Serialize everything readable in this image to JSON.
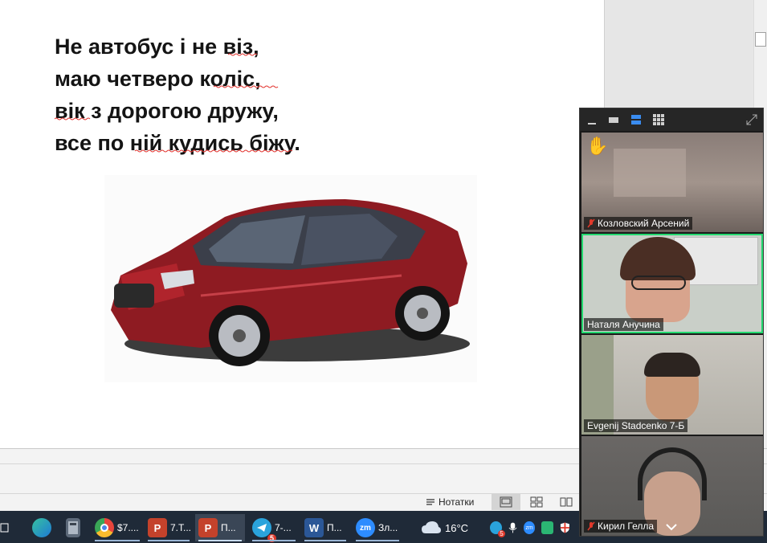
{
  "slide": {
    "poem": [
      "Не автобус і не віз,",
      "маю четверо коліс,",
      "вік з дорогою дружу,",
      "все по ній кудись біжу."
    ],
    "image_icon": "red-sedan-car"
  },
  "statusbar": {
    "notes_label": "Нотатки"
  },
  "zoom": {
    "participants": [
      {
        "name": "Козловский Арсений",
        "muted": true,
        "raised_hand": true
      },
      {
        "name": "Наталя Анучина",
        "muted": false,
        "speaking": true
      },
      {
        "name": "Evgenij Stadcenko 7-Б",
        "muted": false
      },
      {
        "name": "Кирил Гелла",
        "muted": true
      }
    ],
    "colors": {
      "speaking_border": "#23d96f",
      "muted_icon": "#e0392b"
    }
  },
  "taskbar": {
    "items": [
      {
        "icon": "edge-icon",
        "label": ""
      },
      {
        "icon": "calculator-icon",
        "label": ""
      },
      {
        "icon": "chrome-icon",
        "label": "$7...."
      },
      {
        "icon": "powerpoint-icon",
        "label": "7.Т..."
      },
      {
        "icon": "powerpoint-icon",
        "label": "П..."
      },
      {
        "icon": "telegram-icon",
        "label": "7-...",
        "badge": "5"
      },
      {
        "icon": "word-icon",
        "label": "П..."
      },
      {
        "icon": "zoom-icon",
        "label": "Зл..."
      }
    ],
    "weather": "16°C",
    "tray_badge": "5"
  }
}
